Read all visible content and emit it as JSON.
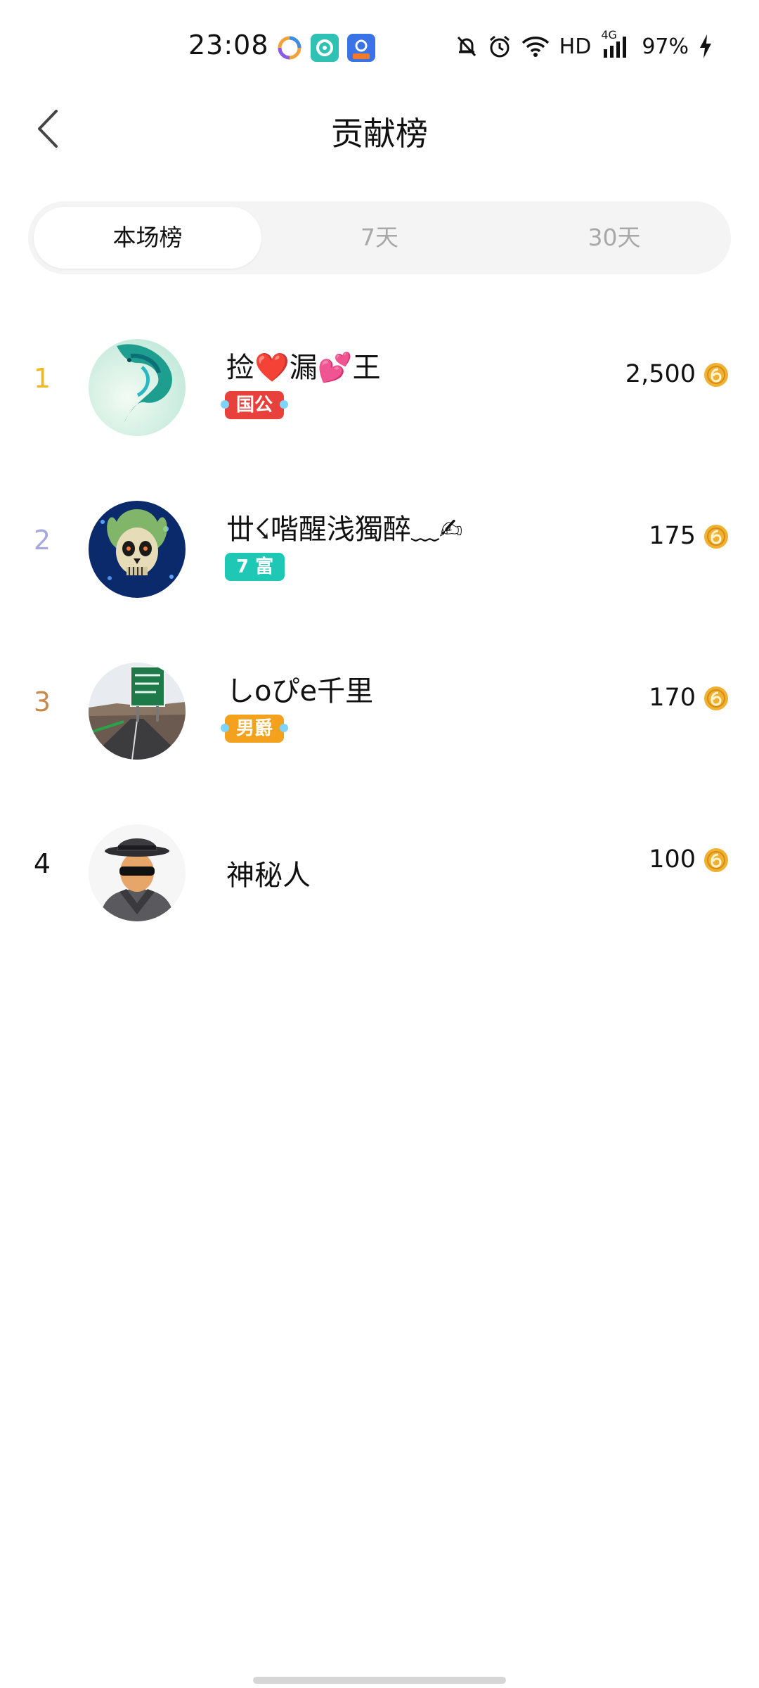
{
  "status_bar": {
    "time": "23:08",
    "network": "HD",
    "network_gen": "4G",
    "battery": "97%"
  },
  "header": {
    "title": "贡献榜"
  },
  "tabs": [
    {
      "label": "本场榜",
      "active": true
    },
    {
      "label": "7天",
      "active": false
    },
    {
      "label": "30天",
      "active": false
    }
  ],
  "ranking": [
    {
      "rank": "1",
      "rank_color": "#f2b51c",
      "name": "捡❤️漏💕王",
      "badge": "国公",
      "badge_color": "#e8413c",
      "score": "2,500",
      "avatar": "dragon-avatar"
    },
    {
      "rank": "2",
      "rank_color": "#a7a8e0",
      "name": "丗☇喈醒浅獨醉﹏✍",
      "badge": "7 富",
      "badge_color": "#1ec8b4",
      "score": "175",
      "avatar": "skull-avatar"
    },
    {
      "rank": "3",
      "rank_color": "#c88a4a",
      "name": "しoぴe千里",
      "badge": "男爵",
      "badge_color": "#f4a21d",
      "score": "170",
      "avatar": "highway-sign-avatar"
    },
    {
      "rank": "4",
      "rank_color": "#111111",
      "name": "神秘人",
      "badge": "",
      "badge_color": "",
      "score": "100",
      "avatar": "mystery-man-avatar"
    }
  ],
  "colors": {
    "coin": "#f0b132",
    "tab_bg": "#f4f4f4",
    "inactive_tab_text": "#a8a8a8"
  }
}
